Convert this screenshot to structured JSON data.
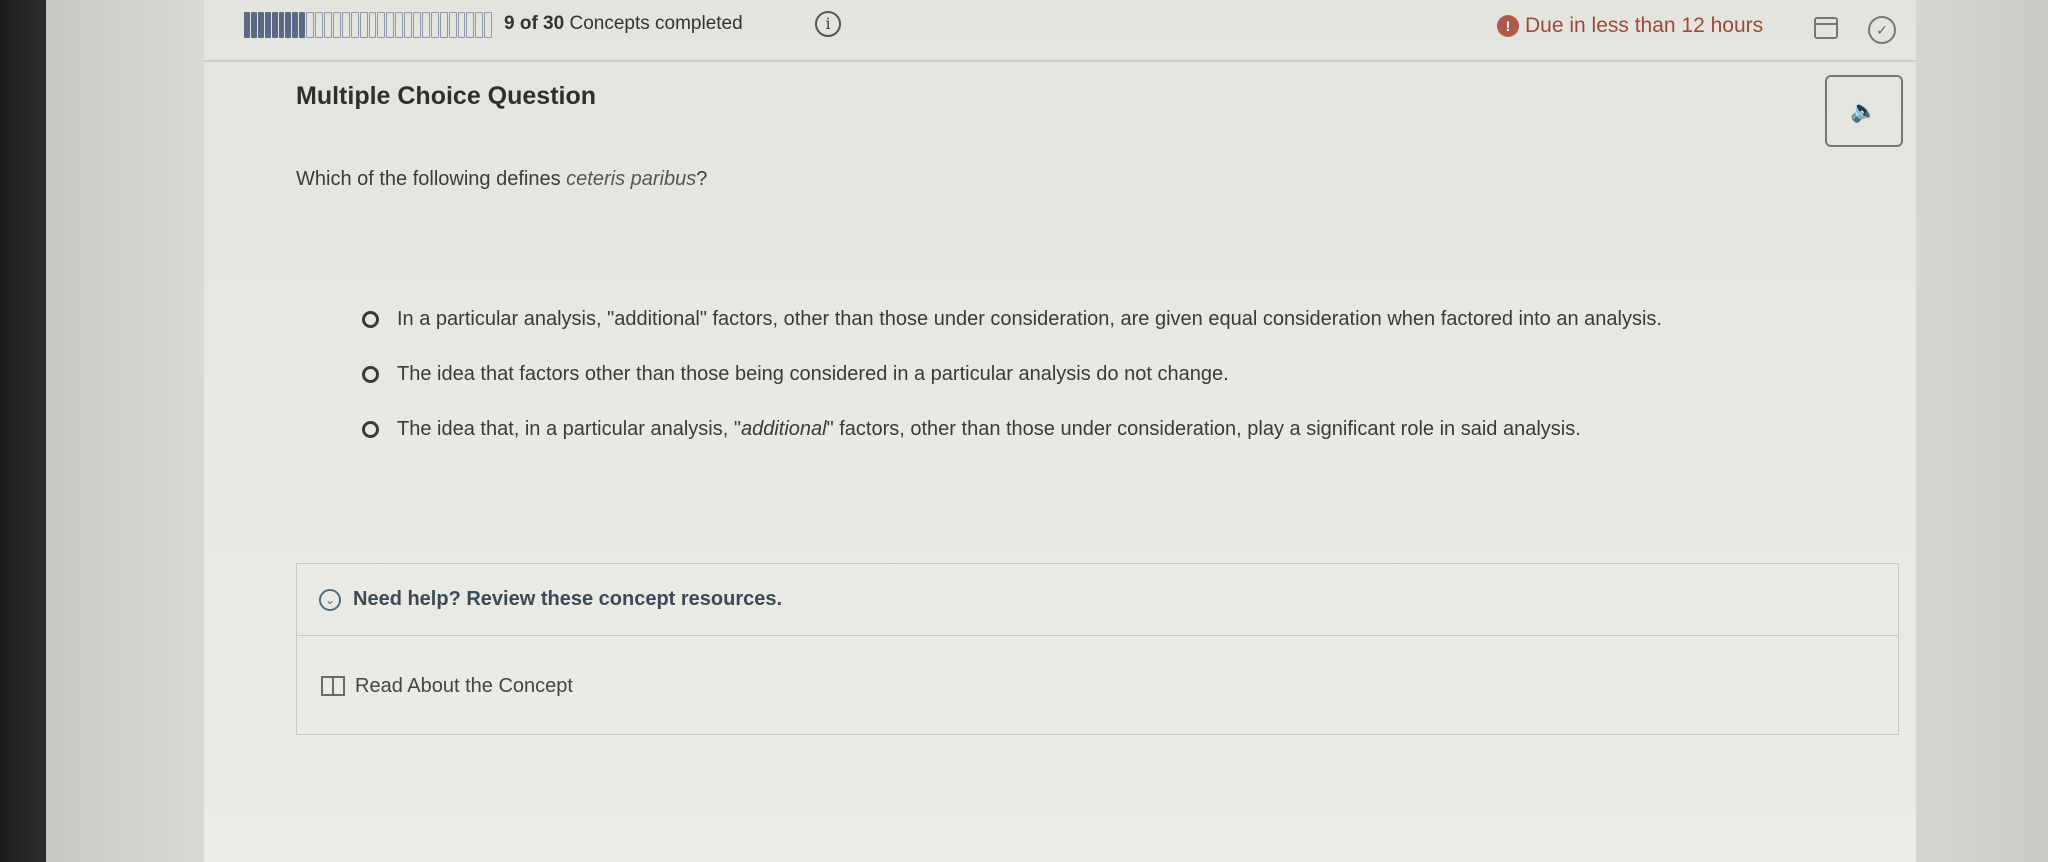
{
  "header": {
    "progress": {
      "completed": 9,
      "total": 30
    },
    "concepts_count": "9 of 30",
    "concepts_label": "Concepts completed",
    "due_text": "Due in less than 12 hours",
    "due_icon": "!",
    "info_icon": "i",
    "check_icon": "✓"
  },
  "question": {
    "type_label": "Multiple Choice Question",
    "prompt_before": "Which of the following defines ",
    "prompt_term": "ceteris paribus",
    "prompt_after": "?",
    "audio_icon": "🔈"
  },
  "options": [
    {
      "text": "In a particular analysis, \"additional\" factors, other than those under consideration, are given equal consideration when factored into an analysis."
    },
    {
      "text": "The idea that factors other than those being considered in a particular analysis do not change."
    },
    {
      "text_before": "The idea that, in a particular analysis, \"",
      "text_italic": "additional",
      "text_after": "\" factors, other than those under consideration, play a significant role in said analysis."
    }
  ],
  "help": {
    "title": "Need help? Review these concept resources.",
    "chevron_icon": "⌄",
    "link_label": "Read About the Concept"
  },
  "colors": {
    "due": "#9a4a3a",
    "progress_done": "#5a6a86"
  }
}
